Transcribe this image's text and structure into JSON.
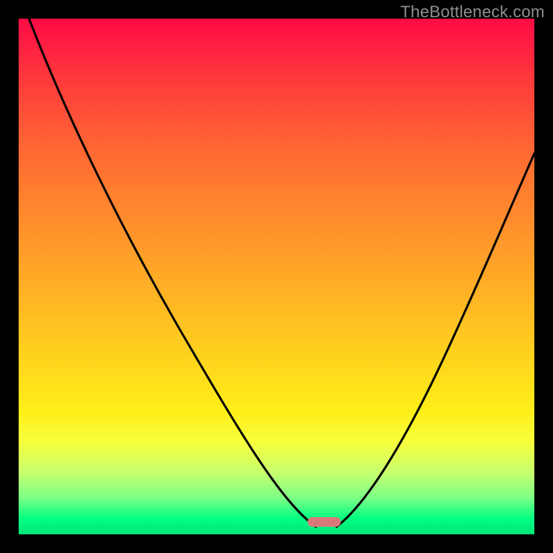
{
  "attribution": "TheBottleneck.com",
  "chart_data": {
    "type": "line",
    "title": "",
    "xlabel": "",
    "ylabel": "",
    "xlim": [
      0,
      100
    ],
    "ylim": [
      0,
      100
    ],
    "series": [
      {
        "name": "bottleneck-curve",
        "x": [
          2,
          6,
          12,
          18,
          24,
          30,
          36,
          42,
          47,
          50,
          53,
          56,
          58,
          59,
          60,
          61,
          64,
          68,
          73,
          80,
          88,
          96,
          100
        ],
        "values": [
          100,
          92,
          82,
          72,
          62,
          52,
          42,
          31,
          21,
          14,
          8,
          3,
          1,
          0,
          0,
          1,
          5,
          12,
          22,
          37,
          55,
          73,
          81
        ]
      }
    ],
    "minimum_marker": {
      "x_center": 59.5,
      "x_width": 6,
      "color": "#d9787a"
    },
    "gradient_stops": [
      {
        "pos": 0,
        "color": "#ff0b45"
      },
      {
        "pos": 40,
        "color": "#ff8f2c"
      },
      {
        "pos": 76,
        "color": "#ffee18"
      },
      {
        "pos": 97,
        "color": "#00ff80"
      },
      {
        "pos": 100,
        "color": "#00e57a"
      }
    ]
  }
}
